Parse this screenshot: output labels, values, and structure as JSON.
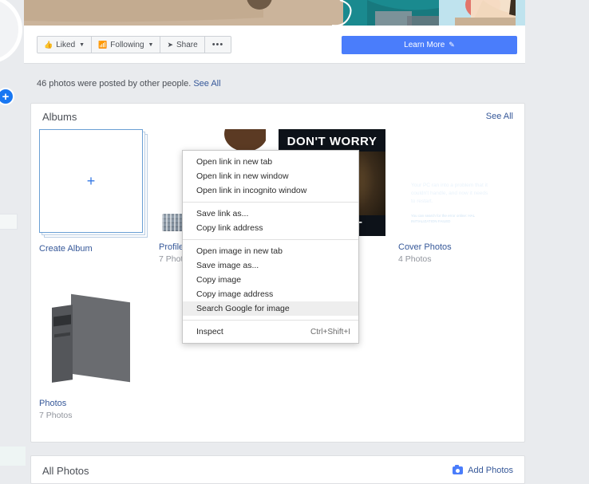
{
  "cover": {
    "alt": "cover-photo-illustration"
  },
  "action_bar": {
    "liked_label": "Liked",
    "following_label": "Following",
    "share_label": "Share",
    "more_label": "•••",
    "learn_more_label": "Learn More"
  },
  "posted_note": {
    "text": "46 photos were posted by other people.",
    "see_all": "See All"
  },
  "albums_section": {
    "title": "Albums",
    "see_all": "See All",
    "albums": [
      {
        "name": "Create Album",
        "count": "",
        "kind": "create"
      },
      {
        "name": "Profile Pictures",
        "count": "7 Photos",
        "kind": "profile"
      },
      {
        "name": "",
        "count": "",
        "kind": "meme",
        "meme_top": "DON'T WORRY",
        "meme_bottom": "SUPPORT"
      },
      {
        "name": "Cover Photos",
        "count": "4 Photos",
        "kind": "bsod",
        "bsod_face": ":(",
        "bsod_message": "Your PC ran into a problem that it couldn't handle, and now it needs to restart.",
        "bsod_sub": "You can search for the error online: HAL INITIALIZATION FAILED"
      },
      {
        "name": "Photos",
        "count": "7 Photos",
        "kind": "pc"
      }
    ],
    "create_plus": "+"
  },
  "all_photos_section": {
    "title": "All Photos",
    "add_photos_label": "Add Photos"
  },
  "context_menu": {
    "groups": [
      [
        {
          "label": "Open link in new tab",
          "shortcut": "",
          "highlight": false
        },
        {
          "label": "Open link in new window",
          "shortcut": "",
          "highlight": false
        },
        {
          "label": "Open link in incognito window",
          "shortcut": "",
          "highlight": false
        }
      ],
      [
        {
          "label": "Save link as...",
          "shortcut": "",
          "highlight": false
        },
        {
          "label": "Copy link address",
          "shortcut": "",
          "highlight": false
        }
      ],
      [
        {
          "label": "Open image in new tab",
          "shortcut": "",
          "highlight": false
        },
        {
          "label": "Save image as...",
          "shortcut": "",
          "highlight": false
        },
        {
          "label": "Copy image",
          "shortcut": "",
          "highlight": false
        },
        {
          "label": "Copy image address",
          "shortcut": "",
          "highlight": false
        },
        {
          "label": "Search Google for image",
          "shortcut": "",
          "highlight": true
        }
      ],
      [
        {
          "label": "Inspect",
          "shortcut": "Ctrl+Shift+I",
          "highlight": false
        }
      ]
    ]
  },
  "colors": {
    "page_bg": "#e9ebee",
    "card_bg": "#ffffff",
    "link_blue": "#365899",
    "accent_blue": "#4a7dfb",
    "bsod_blue": "#1e72b8",
    "muted_text": "#90949c"
  },
  "left_rail": {
    "plus_badge": "+"
  }
}
